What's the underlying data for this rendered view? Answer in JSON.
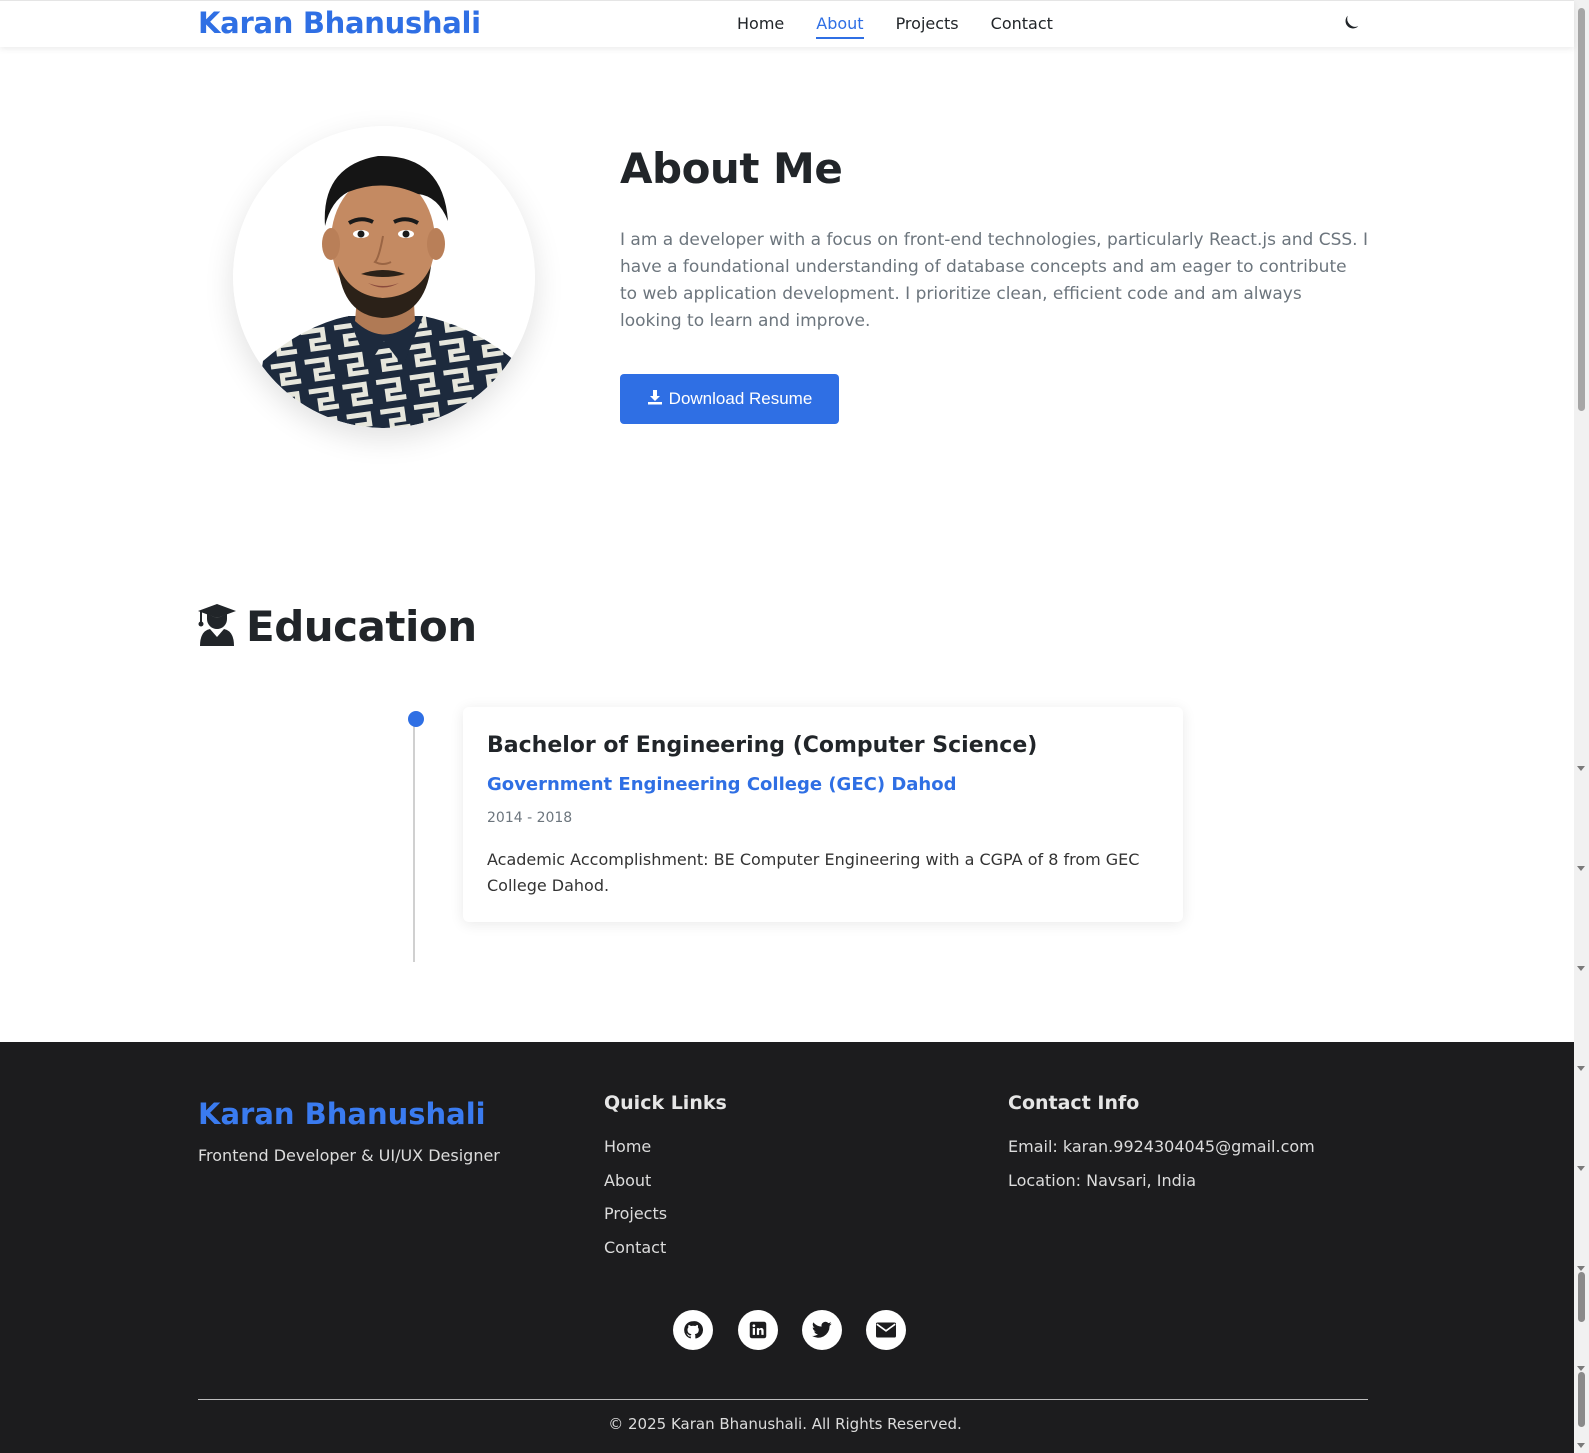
{
  "nav": {
    "brand": "Karan Bhanushali",
    "links": [
      "Home",
      "About",
      "Projects",
      "Contact"
    ],
    "active": "About",
    "theme_icon": "moon-icon"
  },
  "about": {
    "title": "About Me",
    "text": "I am a developer with a focus on front-end technologies, particularly React.js and CSS. I have a foundational understanding of database concepts and am eager to contribute to web application development. I prioritize clean, efficient code and am always looking to learn and improve.",
    "button_label": "Download Resume",
    "button_icon": "download-icon"
  },
  "education": {
    "title": "Education",
    "icon": "graduate-icon",
    "entries": [
      {
        "degree": "Bachelor of Engineering (Computer Science)",
        "college": "Government Engineering College (GEC) Dahod",
        "years": "2014 - 2018",
        "description": "Academic Accomplishment: BE Computer Engineering with a CGPA of 8 from GEC College Dahod."
      }
    ]
  },
  "footer": {
    "brand": "Karan Bhanushali",
    "tagline": "Frontend Developer & UI/UX Designer",
    "quick_links_title": "Quick Links",
    "quick_links": [
      "Home",
      "About",
      "Projects",
      "Contact"
    ],
    "contact_title": "Contact Info",
    "email": "Email: karan.9924304045@gmail.com",
    "location": "Location: Navsari, India",
    "socials": [
      "github-icon",
      "linkedin-icon",
      "twitter-icon",
      "email-icon"
    ],
    "copyright": "© 2025 Karan Bhanushali. All Rights Reserved."
  },
  "colors": {
    "accent": "#2f6fe4",
    "footer_bg": "#1c1c1e"
  }
}
